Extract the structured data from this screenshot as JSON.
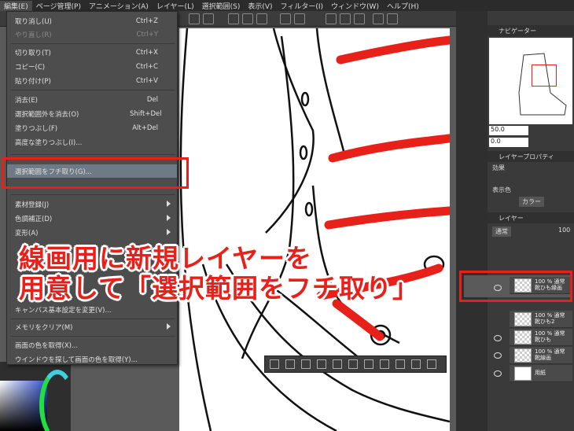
{
  "menubar": {
    "items": [
      "編集(E)",
      "ページ管理(P)",
      "アニメーション(A)",
      "レイヤー(L)",
      "選択範囲(S)",
      "表示(V)",
      "フィルター(I)",
      "ウィンドウ(W)",
      "ヘルプ(H)"
    ],
    "active_index": 0
  },
  "edit_menu": {
    "items": [
      {
        "label": "取り消し(U)",
        "shortcut": "Ctrl+Z",
        "disabled": false
      },
      {
        "label": "やり直し(R)",
        "shortcut": "Ctrl+Y",
        "disabled": true
      },
      {
        "label": "切り取り(T)",
        "shortcut": "Ctrl+X",
        "disabled": false
      },
      {
        "label": "コピー(C)",
        "shortcut": "Ctrl+C",
        "disabled": false
      },
      {
        "label": "貼り付け(P)",
        "shortcut": "Ctrl+V",
        "disabled": false
      },
      {
        "label": "消去(E)",
        "shortcut": "Del",
        "disabled": false
      },
      {
        "label": "選択範囲外を消去(O)",
        "shortcut": "Shift+Del",
        "disabled": false
      },
      {
        "label": "塗りつぶし(F)",
        "shortcut": "Alt+Del",
        "disabled": false
      },
      {
        "label": "高度な塗りつぶし(I)...",
        "shortcut": "",
        "disabled": false
      },
      {
        "label": "選択範囲をフチ取り(G)...",
        "shortcut": "",
        "disabled": false,
        "highlighted": true
      },
      {
        "label": "素材登録(J)",
        "shortcut": "",
        "submenu": true
      },
      {
        "label": "色調補正(D)",
        "shortcut": "",
        "submenu": true
      },
      {
        "label": "変形(A)",
        "shortcut": "",
        "submenu": true
      },
      {
        "label": "キャンバス基本設定を変更(V)...",
        "shortcut": ""
      },
      {
        "label": "メモリをクリア(M)",
        "shortcut": "",
        "submenu": true
      },
      {
        "label": "画面の色を取得(X)...",
        "shortcut": ""
      },
      {
        "label": "ウインドウを探して画面の色を取得(Y)...",
        "shortcut": ""
      }
    ]
  },
  "right_panel": {
    "navigator_tab": "ナビゲーター",
    "zoom": "50.0",
    "angle": "0.0",
    "layer_property_tab": "レイヤープロパティ",
    "effect_label": "効果",
    "display_color_label": "表示色",
    "color_select": "カラー",
    "layer_tab": "レイヤー",
    "blend_mode": "通常",
    "opacity": "100",
    "layers": [
      {
        "line1": "100 % 通常",
        "line2": "靴ひも縁画",
        "selected": true
      },
      {
        "line1": "100 % 通常",
        "line2": "靴ひも2"
      },
      {
        "line1": "100 % 通常",
        "line2": "靴ひも"
      },
      {
        "line1": "100 % 通常",
        "line2": "靴線画"
      },
      {
        "line1": "",
        "line2": "用紙"
      }
    ]
  },
  "caption": {
    "line1": "線画用に新規レイヤーを",
    "line2": "用意して「選択範囲をフチ取り」"
  },
  "colors": {
    "accent_red": "#e8201a",
    "menu_bg": "#4d4d4d",
    "panel_bg": "#3a3a3a"
  }
}
